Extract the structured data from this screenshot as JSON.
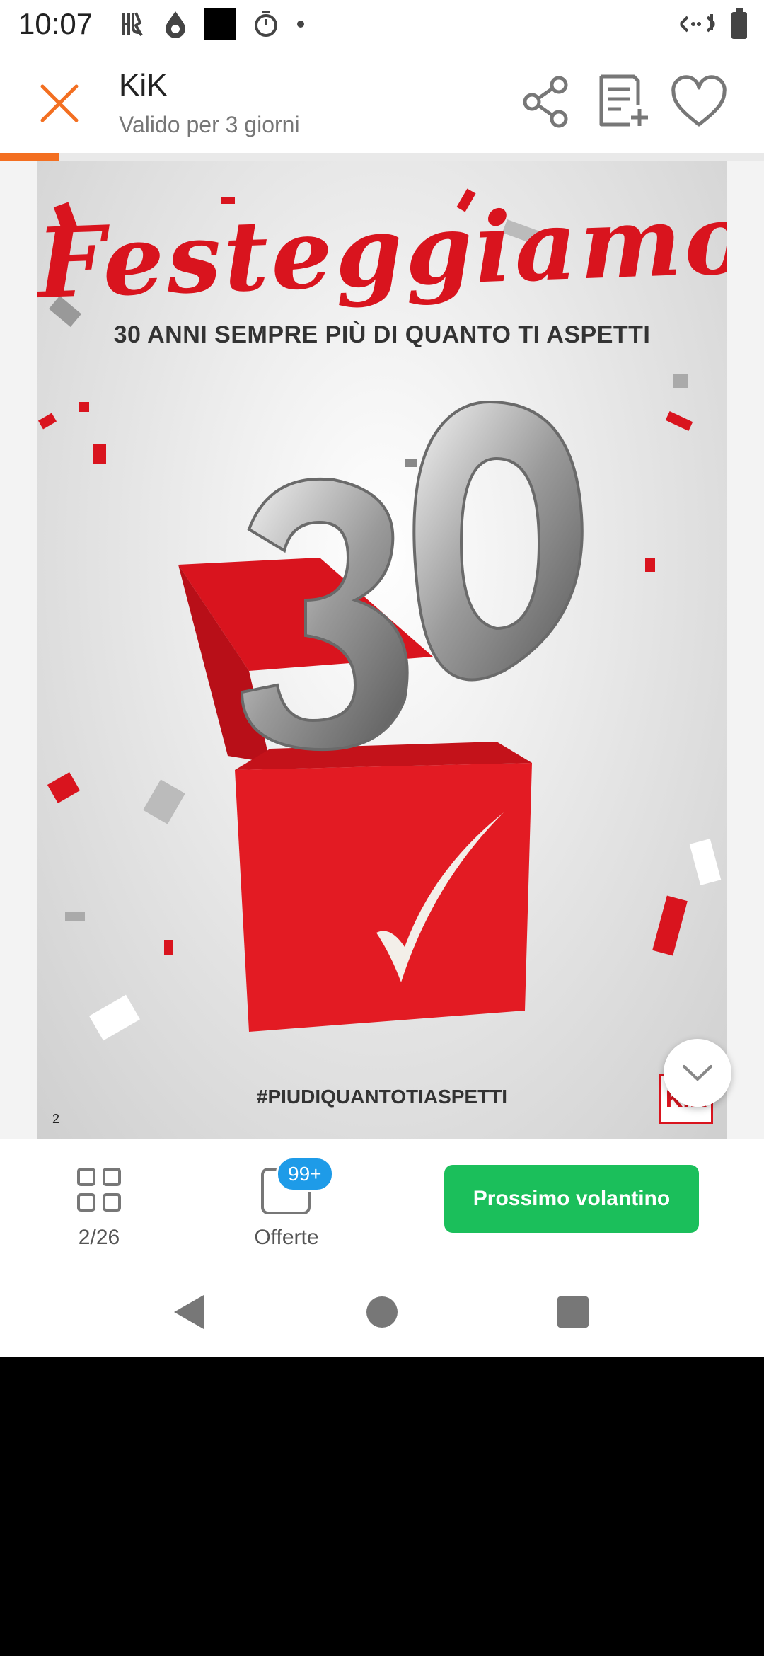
{
  "status_bar": {
    "time": "10:07",
    "icons": [
      "harry-potter-icon",
      "drop-icon",
      "black-square-icon",
      "timer-icon",
      "dot-icon",
      "network-icon",
      "battery-icon"
    ]
  },
  "app_bar": {
    "store_name": "KiK",
    "validity": "Valido per 3 giorni",
    "accent_color": "#f36f21"
  },
  "progress": {
    "fraction": 0.077
  },
  "flyer": {
    "title": "Festeggiamo",
    "subtitle": "30 ANNI SEMPRE PIÙ DI QUANTO TI ASPETTI",
    "hashtag": "#PIUDIQUANTOTIASPETTI",
    "page_number": "2",
    "logo_text": "KiK",
    "balloon_text": "30",
    "brand_color": "#d9141e"
  },
  "bottom_bar": {
    "pages_label": "2/26",
    "offers_label": "Offerte",
    "offers_badge": "99+",
    "next_button": "Prossimo volantino",
    "next_button_color": "#1bbf5b"
  },
  "nav_bar": {
    "icons": [
      "back-icon",
      "home-icon",
      "recents-icon"
    ]
  }
}
